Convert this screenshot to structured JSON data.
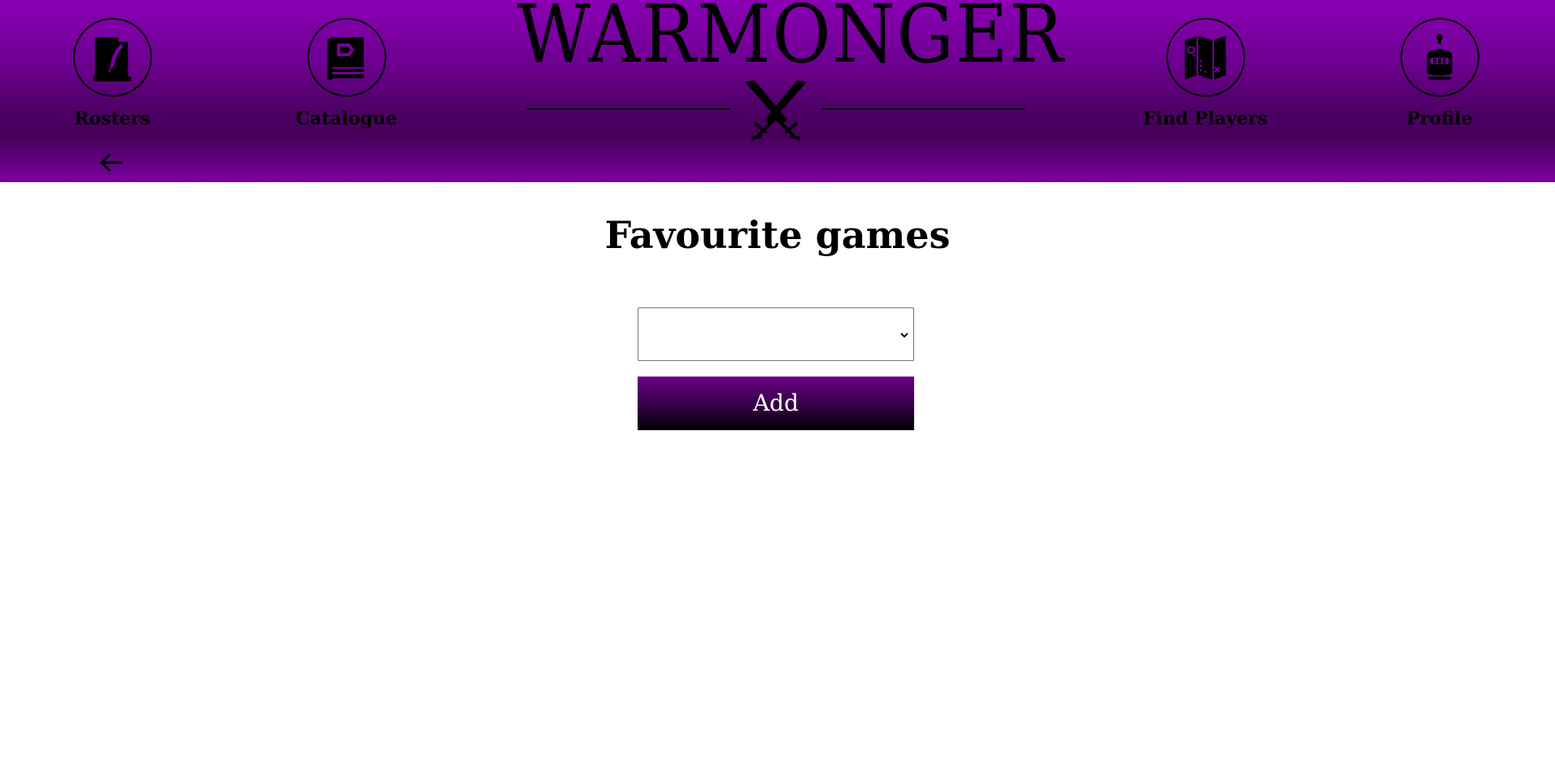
{
  "nav": {
    "rosters": {
      "label": "Rosters",
      "icon": "scroll-quill-icon"
    },
    "catalogue": {
      "label": "Catalogue",
      "icon": "book-icon"
    },
    "find_players": {
      "label": "Find Players",
      "icon": "map-icon"
    },
    "profile": {
      "label": "Profile",
      "icon": "knight-helmet-icon"
    },
    "back_icon": "arrow-left-icon"
  },
  "logo": {
    "text": "WARMONGER",
    "emblem": "crossed-swords-icon"
  },
  "main": {
    "title": "Favourite games",
    "select": {
      "value": "",
      "options": []
    },
    "add_label": "Add"
  },
  "colors": {
    "header_top": "#8a00b4",
    "header_dark": "#45005a",
    "button_top": "#6a0088",
    "button_bottom": "#000000"
  }
}
